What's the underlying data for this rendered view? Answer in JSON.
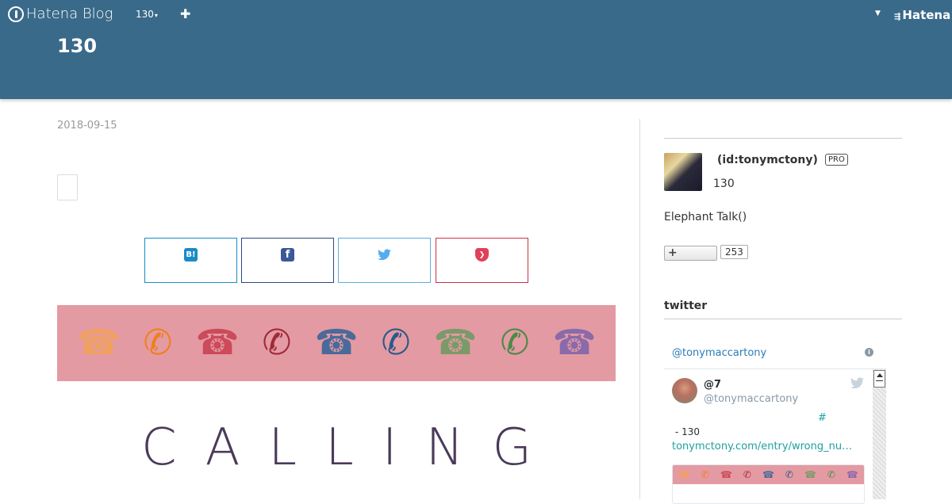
{
  "header": {
    "logo_text": "Hatena Blog",
    "blog_menu_label": "130",
    "add_icon": "plus-icon",
    "hatena_label": "Hatena",
    "blog_title": "130",
    "bg_color": "#3a6a8a"
  },
  "entry": {
    "date": "2018-09-15",
    "share": {
      "hatena": "B!",
      "facebook": "f",
      "twitter": "bird-icon",
      "pocket": "pocket-icon"
    },
    "banner_phones": [
      "☎",
      "✆",
      "☎",
      "✆",
      "☎",
      "✆",
      "☎",
      "✆",
      "☎"
    ],
    "banner_colors": [
      "#f0a060",
      "#ee8020",
      "#cc4a5a",
      "#a02a3a",
      "#4a6a9a",
      "#2a5a8a",
      "#7a9a6a",
      "#4a8a4a",
      "#8a6aaa"
    ],
    "calling_text": "CALLING"
  },
  "sidebar": {
    "profile": {
      "id_text": "(id:tonymctony)",
      "pro_badge": "PRO",
      "name": "130",
      "description": "Elephant Talk()",
      "follow_label": "+",
      "follow_count": "253"
    },
    "twitter": {
      "heading": "twitter",
      "timeline_handle": "@tonymaccartony",
      "tweet": {
        "name": "@7",
        "handle": "@tonymaccartony",
        "hashtag": "#",
        "text": "- 130",
        "link": "tonymctony.com/entry/wrong_nu…"
      }
    }
  }
}
